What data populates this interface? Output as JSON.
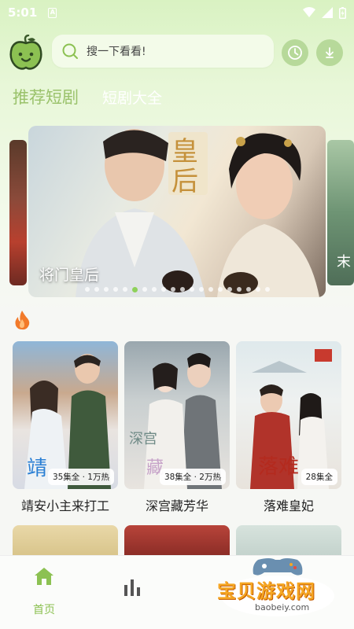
{
  "status_bar": {
    "time": "5:01"
  },
  "header": {
    "search_placeholder": "搜一下看看!",
    "icons": [
      "app-logo-icon",
      "search-icon",
      "history-icon",
      "download-icon"
    ]
  },
  "tabs": [
    {
      "label": "推荐短剧",
      "active": true
    },
    {
      "label": "短剧大全",
      "active": false
    }
  ],
  "banner": {
    "title": "将门皇后",
    "right_edge_text": "末",
    "dot_count": 20,
    "active_dot": 5
  },
  "section_icon": "fire-icon",
  "dramas": [
    {
      "name": "靖安小主来打工",
      "badge": "35集全 · 1万热"
    },
    {
      "name": "深宫藏芳华",
      "badge": "38集全 · 2万热"
    },
    {
      "name": "落难皇妃",
      "badge": "28集全"
    }
  ],
  "bottom_nav": [
    {
      "label": "首页",
      "icon": "home-icon",
      "active": true
    },
    {
      "label": "",
      "icon": "chart-icon",
      "active": false
    }
  ],
  "watermark": {
    "text": "宝贝游戏网",
    "url": "baobeiy.com"
  },
  "colors": {
    "accent": "#9ac26b",
    "active_nav": "#8cc152",
    "dot_active": "#8ed15a"
  }
}
